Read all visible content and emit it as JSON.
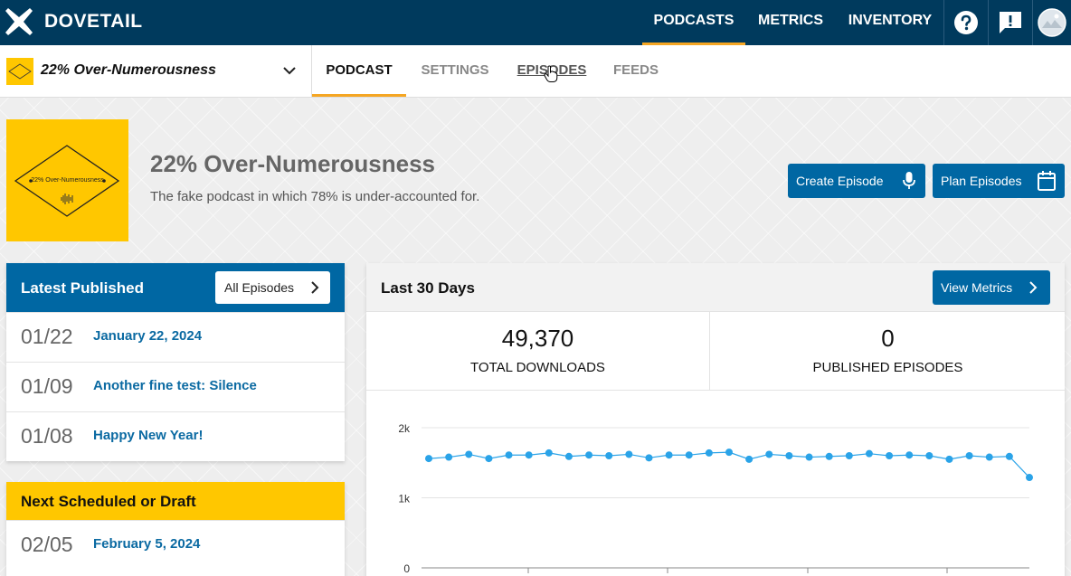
{
  "topnav": {
    "logo_text": "DOVETAIL",
    "items": [
      {
        "label": "PODCASTS",
        "active": true
      },
      {
        "label": "METRICS",
        "active": false
      },
      {
        "label": "INVENTORY",
        "active": false
      }
    ],
    "icons": [
      "help-icon",
      "feedback-icon",
      "user-avatar"
    ]
  },
  "podcast_selector": {
    "name": "22% Over-Numerousness"
  },
  "tabs": [
    {
      "label": "PODCAST",
      "active": true
    },
    {
      "label": "SETTINGS",
      "active": false
    },
    {
      "label": "EPISODES",
      "active": false,
      "hovered": true
    },
    {
      "label": "FEEDS",
      "active": false
    }
  ],
  "podcast": {
    "title": "22% Over-Numerousness",
    "description": "The fake podcast in which 78% is under-accounted for.",
    "cover_text": "22% Over-Numerousness"
  },
  "actions": {
    "create_episode": "Create Episode",
    "plan_episodes": "Plan Episodes"
  },
  "latest_published": {
    "title": "Latest Published",
    "all_button": "All Episodes",
    "episodes": [
      {
        "date": "01/22",
        "title": "January 22, 2024"
      },
      {
        "date": "01/09",
        "title": "Another fine test: Silence"
      },
      {
        "date": "01/08",
        "title": "Happy New Year!"
      }
    ]
  },
  "next_scheduled": {
    "title": "Next Scheduled or Draft",
    "episodes": [
      {
        "date": "02/05",
        "title": "February 5, 2024"
      }
    ]
  },
  "metrics": {
    "title": "Last 30 Days",
    "view_button": "View Metrics",
    "total_downloads": {
      "value": "49,370",
      "label": "TOTAL DOWNLOADS"
    },
    "published_episodes": {
      "value": "0",
      "label": "PUBLISHED EPISODES"
    }
  },
  "colors": {
    "nav_bg": "#003a5d",
    "accent": "#f5a623",
    "primary_blue": "#0067a3",
    "cover_yellow": "#ffc700",
    "line_color": "#2aa3e8"
  },
  "chart_data": {
    "type": "line",
    "title": "",
    "xlabel": "",
    "ylabel": "",
    "yticks": [
      "2k",
      "1k",
      "0"
    ],
    "ylim": [
      0,
      2000
    ],
    "grid": true,
    "series": [
      {
        "values": [
          1560,
          1580,
          1620,
          1560,
          1610,
          1610,
          1640,
          1590,
          1610,
          1600,
          1620,
          1570,
          1610,
          1610,
          1640,
          1650,
          1550,
          1620,
          1600,
          1580,
          1590,
          1600,
          1630,
          1600,
          1610,
          1600,
          1550,
          1600,
          1580,
          1590,
          1290
        ]
      }
    ]
  }
}
